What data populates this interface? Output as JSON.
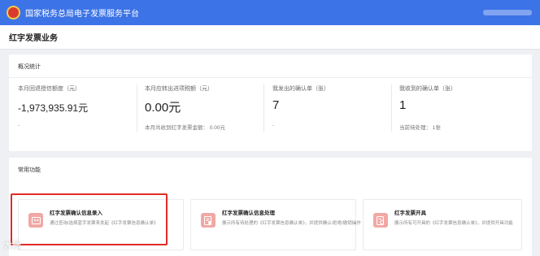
{
  "header": {
    "title": "国家税务总局电子发票服务平台"
  },
  "page": {
    "title": "红字发票业务"
  },
  "overview": {
    "title": "概况统计",
    "stats": [
      {
        "label": "本月回退授信额度（元）",
        "value": "-1,973,935.91元",
        "sub": "-"
      },
      {
        "label": "本月应转出进项税额（元）",
        "value": "0.00元",
        "sub": "本月共收到红字发票金额：  0.00元"
      },
      {
        "label": "我发出的确认单（张）",
        "value": "7",
        "sub": "-"
      },
      {
        "label": "我收到的确认单（张）",
        "value": "1",
        "sub": "当前待处理：  1张"
      }
    ]
  },
  "functions": {
    "title": "常用功能",
    "items": [
      {
        "name": "红字发票确认信息录入",
        "desc": "通过查询/选择蓝字发票来发起《红字发票信息确认单》",
        "icon": "invoice-entry-icon"
      },
      {
        "name": "红字发票确认信息处理",
        "desc": "展示所有待处理的《红字发票信息确认单》，并提供确认/拒绝/撤销操作",
        "icon": "invoice-process-icon"
      },
      {
        "name": "红字发票开具",
        "desc": "展示所有可开具的《红字发票信息确认单》，并提供开具功能",
        "icon": "invoice-issue-icon"
      }
    ]
  },
  "watermark": "大账",
  "colors": {
    "brand": "#3c73e6",
    "highlight": "#e12b26",
    "iconBg": "#f0a8a4"
  }
}
